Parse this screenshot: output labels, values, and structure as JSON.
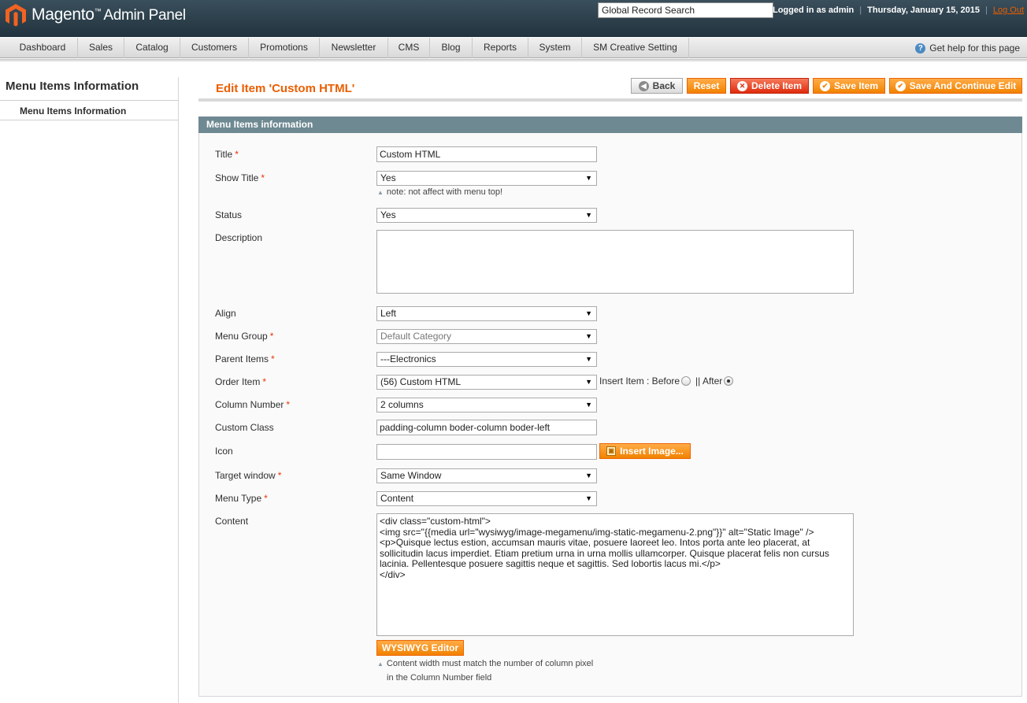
{
  "header": {
    "brand": "Magento",
    "brand_suffix": "Admin Panel",
    "search_value": "Global Record Search",
    "logged_in": "Logged in as admin",
    "date": "Thursday, January 15, 2015",
    "logout": "Log Out",
    "accent": "#eb5e00"
  },
  "nav": {
    "items": [
      "Dashboard",
      "Sales",
      "Catalog",
      "Customers",
      "Promotions",
      "Newsletter",
      "CMS",
      "Blog",
      "Reports",
      "System",
      "SM Creative Setting"
    ],
    "help": "Get help for this page"
  },
  "sidebar": {
    "title": "Menu Items Information",
    "tab": "Menu Items Information"
  },
  "page": {
    "title": "Edit Item 'Custom HTML'"
  },
  "buttons": {
    "back": "Back",
    "reset": "Reset",
    "delete": "Delete Item",
    "save": "Save Item",
    "save_continue": "Save And Continue Edit"
  },
  "fieldset": {
    "title": "Menu Items information"
  },
  "form": {
    "title_label": "Title",
    "title_value": "Custom HTML",
    "show_title_label": "Show Title",
    "show_title_value": "Yes",
    "show_title_note": "note: not affect with menu top!",
    "status_label": "Status",
    "status_value": "Yes",
    "description_label": "Description",
    "description_value": "",
    "align_label": "Align",
    "align_value": "Left",
    "menu_group_label": "Menu Group",
    "menu_group_value": "Default Category",
    "parent_items_label": "Parent Items",
    "parent_items_value": "---Electronics",
    "order_item_label": "Order Item",
    "order_item_value": "(56) Custom HTML",
    "insert_item_text": "Insert Item : Before",
    "insert_item_after": "|| After",
    "column_number_label": "Column Number",
    "column_number_value": "2 columns",
    "custom_class_label": "Custom Class",
    "custom_class_value": "padding-column boder-column boder-left",
    "icon_label": "Icon",
    "icon_value": "",
    "insert_image": "Insert Image...",
    "target_window_label": "Target window",
    "target_window_value": "Same Window",
    "menu_type_label": "Menu Type",
    "menu_type_value": "Content",
    "content_label": "Content",
    "content_value": "<div class=\"custom-html\">\n<img src=\"{{media url=\"wysiwyg/image-megamenu/img-static-megamenu-2.png\"}}\" alt=\"Static Image\" />\n<p>Quisque lectus estion, accumsan mauris vitae, posuere laoreet leo. Intos porta ante leo placerat, at sollicitudin lacus imperdiet. Etiam pretium urna in urna mollis ullamcorper. Quisque placerat felis non cursus lacinia. Pellentesque posuere sagittis neque et sagittis. Sed lobortis lacus mi.</p>\n</div>",
    "wysiwyg": "WYSIWYG Editor",
    "content_note_1": "Content width must match the number of column pixel",
    "content_note_2": "in the Column Number field"
  }
}
